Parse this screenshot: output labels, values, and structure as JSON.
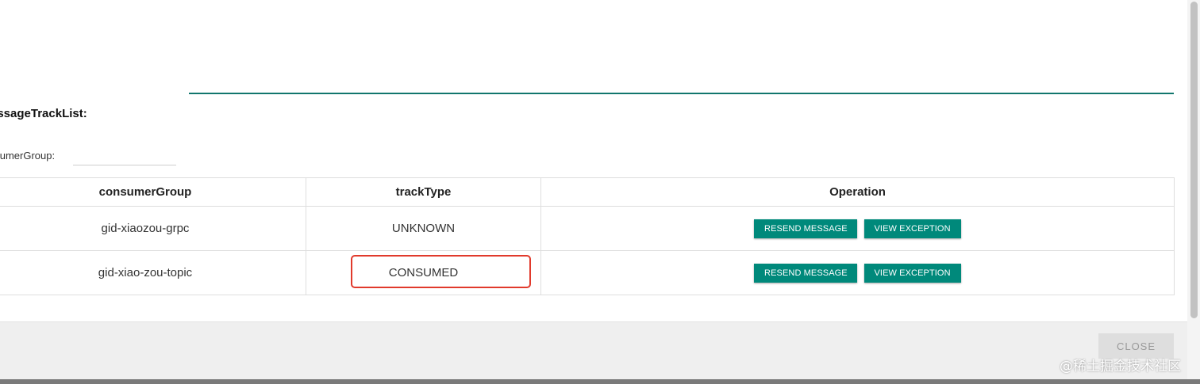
{
  "section": {
    "title": "essageTrackList:",
    "filter_label": "nsumerGroup:",
    "filter_value": ""
  },
  "table": {
    "headers": [
      "consumerGroup",
      "trackType",
      "Operation"
    ],
    "rows": [
      {
        "consumerGroup": "gid-xiaozou-grpc",
        "trackType": "UNKNOWN"
      },
      {
        "consumerGroup": "gid-xiao-zou-topic",
        "trackType": "CONSUMED"
      }
    ],
    "resend_label": "RESEND MESSAGE",
    "view_label": "VIEW EXCEPTION"
  },
  "footer": {
    "close_label": "CLOSE"
  },
  "watermark": "@稀土掘金技术社区",
  "colors": {
    "accent": "#00897b",
    "rule": "#11766d",
    "highlight": "#e13a2c"
  }
}
